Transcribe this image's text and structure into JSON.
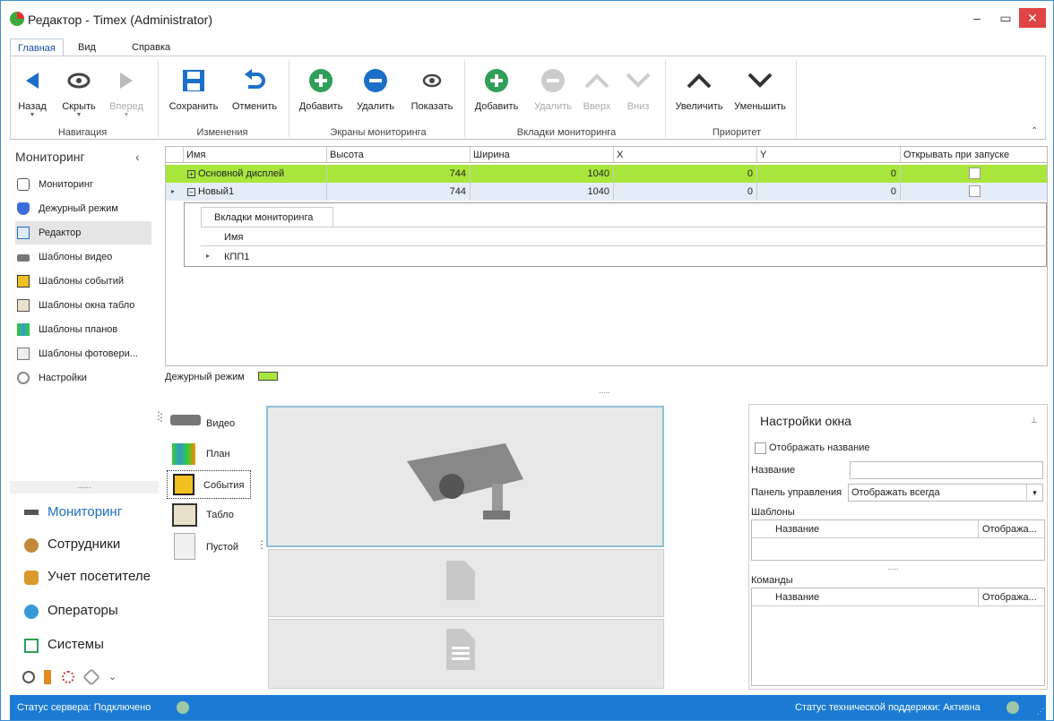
{
  "window": {
    "title": "Редактор - Timex (Administrator)"
  },
  "menu": {
    "items": [
      "Главная",
      "Вид",
      "Справка"
    ]
  },
  "ribbon": {
    "buttons": {
      "back": "Назад",
      "hide": "Скрыть",
      "forward": "Вперед",
      "save": "Сохранить",
      "undo": "Отменить",
      "add_screen": "Добавить",
      "del_screen": "Удалить",
      "show_screen": "Показать",
      "add_tab": "Добавить",
      "del_tab": "Удалить",
      "up": "Вверх",
      "down": "Вниз",
      "increase": "Увеличить",
      "decrease": "Уменьшить"
    },
    "groups": {
      "nav": "Навигация",
      "changes": "Изменения",
      "screens": "Экраны мониторинга",
      "tabs": "Вкладки мониторинга",
      "priority": "Приоритет"
    }
  },
  "sidebar": {
    "title": "Мониторинг",
    "items": [
      "Мониторинг",
      "Дежурный режим",
      "Редактор",
      "Шаблоны видео",
      "Шаблоны событий",
      "Шаблоны окна табло",
      "Шаблоны планов",
      "Шаблоны фотовери...",
      "Настройки"
    ],
    "dots": "......",
    "big": [
      "Мониторинг",
      "Сотрудники",
      "Учет посетителе",
      "Операторы",
      "Системы"
    ]
  },
  "grid": {
    "headers": [
      "Имя",
      "Высота",
      "Ширина",
      "X",
      "Y",
      "Открывать при запуске"
    ],
    "rows": [
      {
        "name": "Основной дисплей",
        "h": "744",
        "w": "1040",
        "x": "0",
        "y": "0"
      },
      {
        "name": "Новый1",
        "h": "744",
        "w": "1040",
        "x": "0",
        "y": "0"
      }
    ],
    "sub_tab": "Вкладки мониторинга",
    "sub_header": "Имя",
    "sub_row": "КПП1"
  },
  "duty": {
    "label": "Дежурный режим"
  },
  "splitter": ".....",
  "toolbox": {
    "items": [
      "Видео",
      "План",
      "События",
      "Табло",
      "Пустой"
    ]
  },
  "panel": {
    "title": "Настройки окна",
    "show_name": "Отображать название",
    "name_label": "Название",
    "cp_label": "Панель управления",
    "cp_value": "Отображать всегда",
    "templates": "Шаблоны",
    "col_name": "Название",
    "col_disp": "Отобража...",
    "dots": ".....",
    "commands": "Команды"
  },
  "status": {
    "server": "Статус сервера: Подключено",
    "support": "Статус технической поддержки: Активна"
  },
  "colors": {
    "accent": "#1b7bd4",
    "highlight_row": "#a8e63c",
    "green": "#2e9e58"
  }
}
